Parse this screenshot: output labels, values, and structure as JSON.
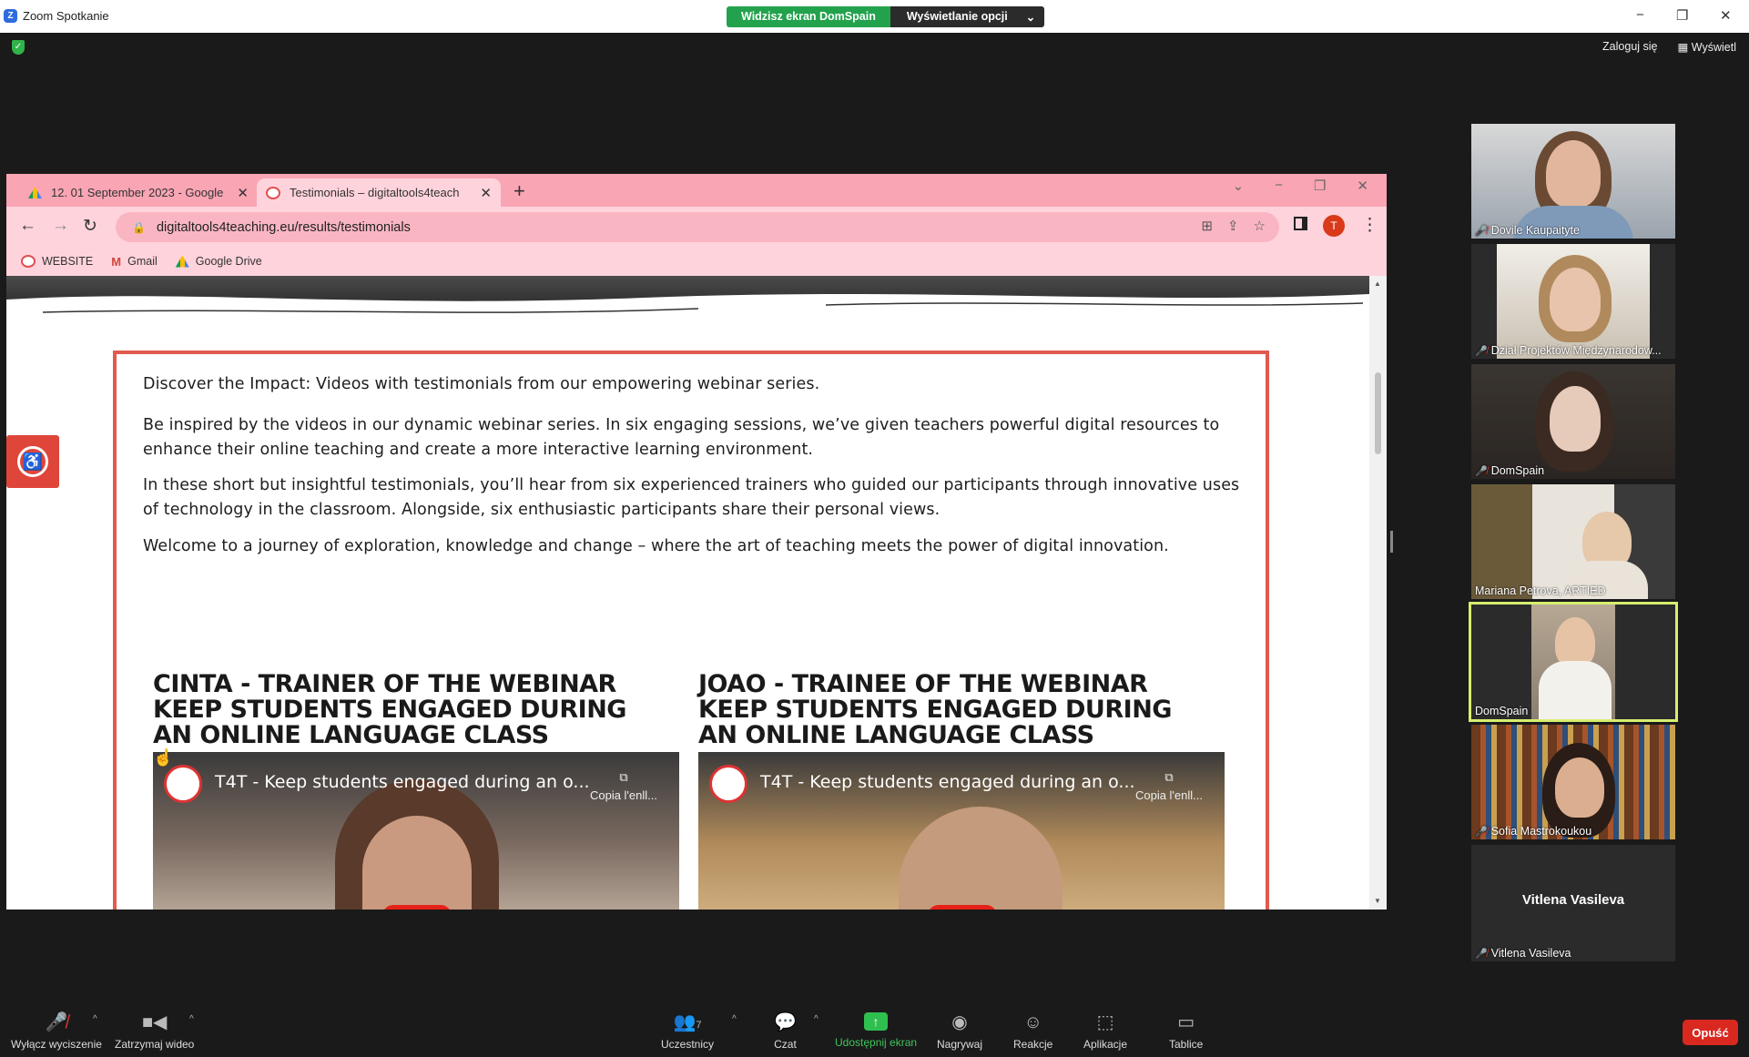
{
  "window": {
    "title": "Zoom Spotkanie",
    "viewing_label": "Widzisz ekran DomSpain",
    "view_options_label": "Wyświetlanie opcji",
    "minimize": "−",
    "restore": "❐",
    "close": "✕"
  },
  "top_right": {
    "login": "Zaloguj się",
    "view": "Wyświetl"
  },
  "browser": {
    "tabs": [
      {
        "label": "12. 01 September 2023 - Google",
        "close": "✕"
      },
      {
        "label": "Testimonials – digitaltools4teach",
        "close": "✕"
      }
    ],
    "new_tab": "+",
    "url": "digitaltools4teaching.eu/results/testimonials",
    "profile_initial": "T",
    "bookmarks": [
      "WEBSITE",
      "Gmail",
      "Google Drive"
    ]
  },
  "page": {
    "paragraphs": [
      "Discover the Impact: Videos with testimonials from our empowering webinar series.",
      "Be inspired by the videos in our dynamic webinar series. In six engaging sessions, we’ve given teachers powerful digital resources to enhance their online teaching and create a more interactive learning environment.",
      "In these short but insightful testimonials, you’ll hear from six experienced trainers who guided our participants through innovative uses of technology in the classroom. Alongside, six enthusiastic participants share their personal views.",
      "Welcome to a journey of exploration, knowledge and change – where the art of teaching meets the power of digital innovation."
    ],
    "columns": [
      {
        "title": "CINTA - TRAINER OF THE WEBINAR KEEP STUDENTS ENGAGED DURING AN ONLINE LANGUAGE CLASS",
        "video_title": "T4T - Keep students engaged during an o...",
        "copy_label": "Copia l'enll..."
      },
      {
        "title": "JOAO - TRAINEE OF THE WEBINAR KEEP STUDENTS ENGAGED DURING AN ONLINE LANGUAGE CLASS",
        "video_title": "T4T - Keep students engaged during an o...",
        "copy_label": "Copia l'enll..."
      }
    ]
  },
  "participants": [
    {
      "name": "Dovile Kaupaityte",
      "muted": true
    },
    {
      "name": "Dział Projektów Międzynarodow...",
      "muted": true
    },
    {
      "name": "DomSpain",
      "muted": true
    },
    {
      "name": "Mariana Petrova, ARTIED",
      "muted": false
    },
    {
      "name": "DomSpain",
      "muted": false,
      "speaking": true
    },
    {
      "name": "Sofia Mastrokoukou",
      "muted": true
    },
    {
      "name": "Vitlena Vasileva",
      "muted": true,
      "video_off": true
    }
  ],
  "toolbar": {
    "mute": "Wyłącz wyciszenie",
    "stop_video": "Zatrzymaj wideo",
    "participants": "Uczestnicy",
    "participants_count": "7",
    "chat": "Czat",
    "share": "Udostępnij ekran",
    "record": "Nagrywaj",
    "reactions": "Reakcje",
    "apps": "Aplikacje",
    "whiteboards": "Tablice",
    "leave": "Opuść"
  },
  "colors": {
    "browser_tab_bar": "#f9a5b4",
    "content_border": "#e05a4e",
    "share_green": "#23a24d",
    "leave_red": "#d9281f",
    "speaker_highlight": "#d6ee6f"
  }
}
